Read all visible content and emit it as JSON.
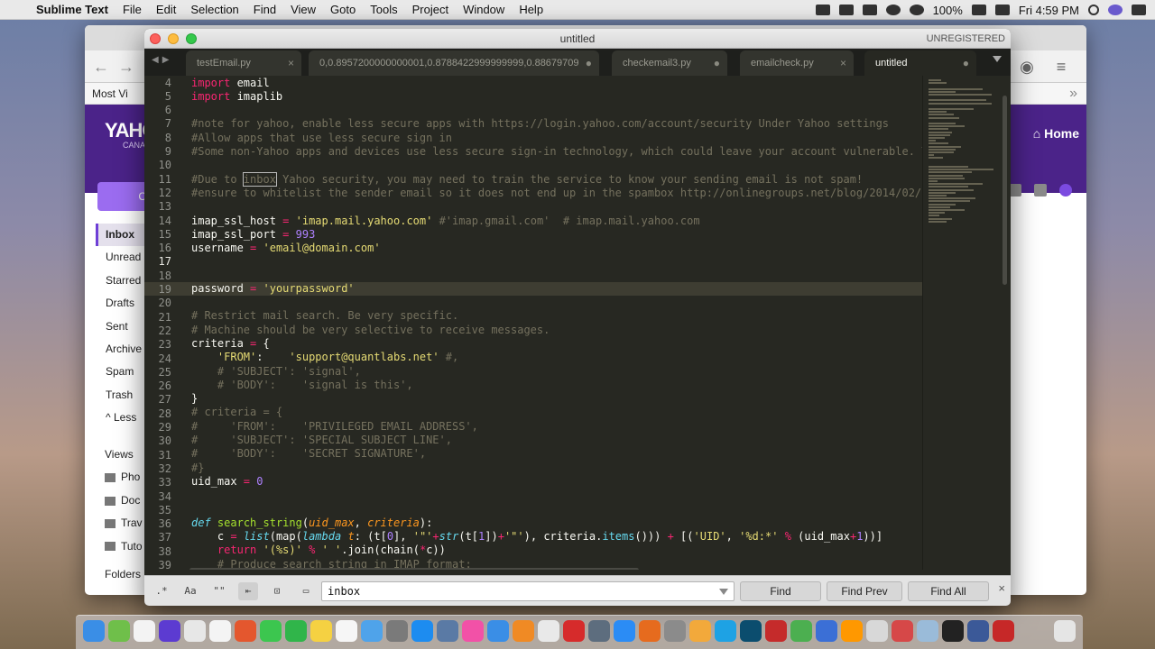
{
  "menubar": {
    "app": "Sublime Text",
    "items": [
      "File",
      "Edit",
      "Selection",
      "Find",
      "View",
      "Goto",
      "Tools",
      "Project",
      "Window",
      "Help"
    ],
    "battery": "100%",
    "clock": "Fri 4:59 PM"
  },
  "browser": {
    "bookmark": "Most Vi",
    "yahoo_logo": "YAHO",
    "yahoo_sub": "CANA",
    "home": "Home",
    "compose_label": "C",
    "folders": [
      "Inbox",
      "Unread",
      "Starred",
      "Drafts",
      "Sent",
      "Archive",
      "Spam",
      "Trash",
      "Less"
    ],
    "views_title": "Views",
    "views": [
      "Pho",
      "Doc",
      "Trav",
      "Tuto"
    ],
    "folders_title": "Folders"
  },
  "sublime": {
    "title": "untitled",
    "unregistered": "UNREGISTERED",
    "tabs": [
      {
        "label": "testEmail.py",
        "marker": "×"
      },
      {
        "label": "0,0.8957200000000001,0.8788422999999999,0.88679709",
        "marker": "●"
      },
      {
        "label": "checkemail3.py",
        "marker": "●"
      },
      {
        "label": "emailcheck.py",
        "marker": "×"
      },
      {
        "label": "untitled",
        "marker": "●"
      }
    ],
    "line_numbers": [
      "4",
      "5",
      "6",
      "7",
      "8",
      "9",
      "10",
      "11",
      "12",
      "13",
      "14",
      "15",
      "16",
      "17",
      "18",
      "19",
      "20",
      "21",
      "22",
      "23",
      "24",
      "25",
      "26",
      "27",
      "28",
      "29",
      "30",
      "31",
      "32",
      "33",
      "34",
      "35",
      "36",
      "37",
      "38",
      "39"
    ],
    "current_line": "17"
  },
  "find": {
    "regex": ".*",
    "case": "Aa",
    "word": "\"\"",
    "wrap": "⇤",
    "selection": "⊡",
    "highlight": "▭",
    "query": "inbox",
    "find_label": "Find",
    "find_prev_label": "Find Prev",
    "find_all_label": "Find All",
    "close": "×"
  },
  "colors": {
    "editor_bg": "#272822",
    "keyword": "#f92672",
    "string": "#e6db74",
    "number": "#ae81ff",
    "comment": "#75715e",
    "function": "#a6e22e",
    "yahoo_purple": "#4b2389"
  }
}
